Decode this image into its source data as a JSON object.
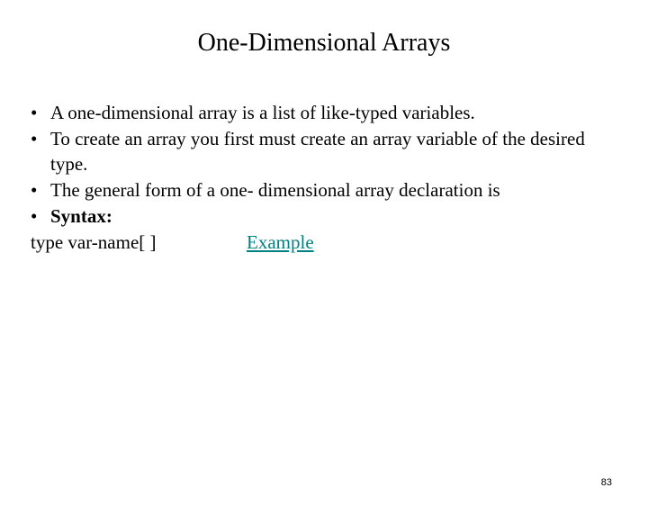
{
  "title": "One-Dimensional Arrays",
  "bullets": [
    "A one-dimensional array is a list of like-typed variables.",
    "To create an array you first must create an array variable of  the desired type.",
    " The general form of a one- dimensional array declaration is",
    "Syntax:"
  ],
  "syntax_line": "type var-name[ ]",
  "example_label": "Example",
  "page_number": "83",
  "bullet_glyph": "•",
  "colors": {
    "link": "#008080",
    "text": "#000000",
    "background": "#ffffff"
  }
}
